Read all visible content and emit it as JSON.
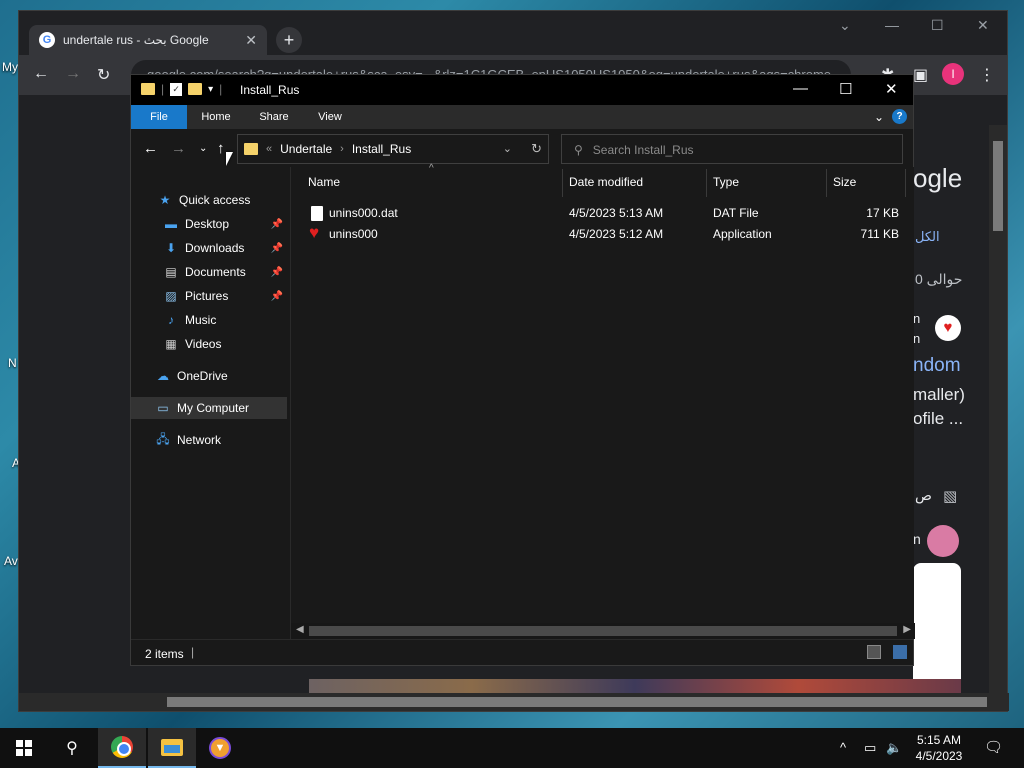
{
  "desktop": {
    "fragments": [
      "My",
      "N",
      "A",
      "Av"
    ]
  },
  "chrome": {
    "tab_title": "undertale rus - بحث Google",
    "favicon": "G",
    "url": "google.com/search?q=undertale+rus&sca_esv=...&rlz=1C1GCEB_enUS1050US1050&oq=undertale+rus&aqs=chrome",
    "profile_initial": "I",
    "page_fragments": [
      "ogle",
      "الكل",
      "حوالى 0",
      "n",
      "n",
      "ndom",
      "maller)",
      "ofile ...",
      "ص",
      "n"
    ]
  },
  "explorer": {
    "title": "Install_Rus",
    "ribbon_tabs": [
      "File",
      "Home",
      "Share",
      "View"
    ],
    "breadcrumb": [
      "Undertale",
      "Install_Rus"
    ],
    "breadcrumb_overflow": "«",
    "search_placeholder": "Search Install_Rus",
    "sidebar": [
      {
        "label": "Quick access",
        "icon": "star-icon",
        "pinned": false
      },
      {
        "label": "Desktop",
        "icon": "desktop-icon",
        "pinned": true
      },
      {
        "label": "Downloads",
        "icon": "download-arrow-icon",
        "pinned": true
      },
      {
        "label": "Documents",
        "icon": "document-icon",
        "pinned": true
      },
      {
        "label": "Pictures",
        "icon": "picture-icon",
        "pinned": true
      },
      {
        "label": "Music",
        "icon": "music-note-icon",
        "pinned": false
      },
      {
        "label": "Videos",
        "icon": "video-icon",
        "pinned": false
      },
      {
        "label": "OneDrive",
        "icon": "cloud-icon",
        "pinned": false
      },
      {
        "label": "My Computer",
        "icon": "computer-icon",
        "pinned": false,
        "selected": true
      },
      {
        "label": "Network",
        "icon": "network-icon",
        "pinned": false
      }
    ],
    "columns": {
      "name": "Name",
      "date": "Date modified",
      "type": "Type",
      "size": "Size"
    },
    "files": [
      {
        "name": "unins000.dat",
        "date": "4/5/2023 5:13 AM",
        "type": "DAT File",
        "size": "17 KB",
        "icon": "file-icon"
      },
      {
        "name": "unins000",
        "date": "4/5/2023 5:12 AM",
        "type": "Application",
        "size": "711 KB",
        "icon": "heart-icon"
      }
    ],
    "status": "2 items"
  },
  "taskbar": {
    "time": "5:15 AM",
    "date": "4/5/2023"
  },
  "colors": {
    "accent": "#1979ca",
    "explorer_bg": "#191919",
    "chrome_bg": "#202124"
  }
}
